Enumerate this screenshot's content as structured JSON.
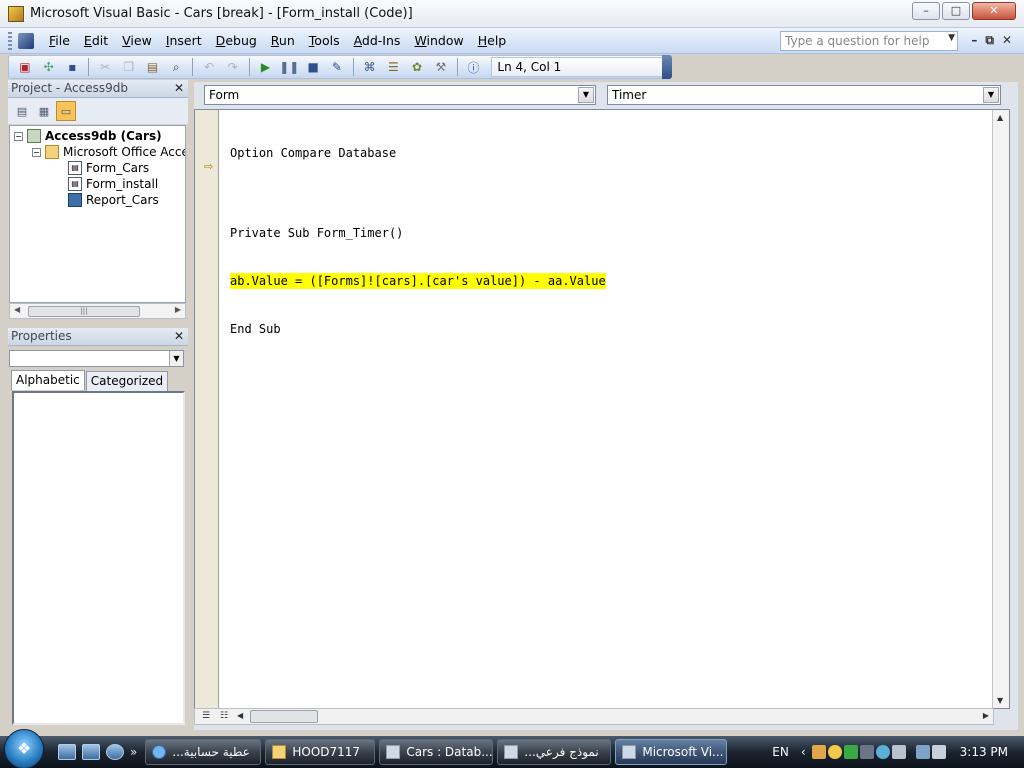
{
  "window": {
    "title": "Microsoft Visual Basic - Cars [break] - [Form_install (Code)]",
    "minimize_glyph": "–",
    "maximize_glyph": "□",
    "close_glyph": "✕"
  },
  "menubar": {
    "items": [
      {
        "prefix": "",
        "key": "F",
        "rest": "ile"
      },
      {
        "prefix": "",
        "key": "E",
        "rest": "dit"
      },
      {
        "prefix": "",
        "key": "V",
        "rest": "iew"
      },
      {
        "prefix": "",
        "key": "I",
        "rest": "nsert"
      },
      {
        "prefix": "",
        "key": "D",
        "rest": "ebug"
      },
      {
        "prefix": "",
        "key": "R",
        "rest": "un"
      },
      {
        "prefix": "",
        "key": "T",
        "rest": "ools"
      },
      {
        "prefix": "",
        "key": "A",
        "rest": "dd-Ins"
      },
      {
        "prefix": "",
        "key": "W",
        "rest": "indow"
      },
      {
        "prefix": "",
        "key": "H",
        "rest": "elp"
      }
    ],
    "help_placeholder": "Type a question for help",
    "mdi_minimize": "–",
    "mdi_restore": "⧉",
    "mdi_close": "✕"
  },
  "toolbar": {
    "position_status": "Ln 4, Col 1"
  },
  "project": {
    "title": "Project - Access9db",
    "close_glyph": "✕",
    "tree": {
      "root": "Access9db (Cars)",
      "folder": "Microsoft Office Access Class Objects",
      "items": [
        "Form_Cars",
        "Form_install",
        "Report_Cars"
      ]
    }
  },
  "properties": {
    "title": "Properties",
    "close_glyph": "✕",
    "tabs": [
      "Alphabetic",
      "Categorized"
    ]
  },
  "code": {
    "object_combo": "Form",
    "procedure_combo": "Timer",
    "lines": [
      "Option Compare Database",
      "",
      "Private Sub Form_Timer()",
      "ab.Value = ([Forms]![cars].[car's value]) - aa.Value",
      "End Sub"
    ]
  },
  "taskbar": {
    "buttons": [
      {
        "label": "عطية حسابية...",
        "icon": "ie"
      },
      {
        "label": "HOOD7117",
        "icon": "folder"
      },
      {
        "label": "Cars : Datab...",
        "icon": "access"
      },
      {
        "label": "نموذج فرعي...",
        "icon": "form"
      },
      {
        "label": "Microsoft Vi...",
        "icon": "vb"
      }
    ],
    "language": "EN",
    "clock": "3:13 PM"
  }
}
